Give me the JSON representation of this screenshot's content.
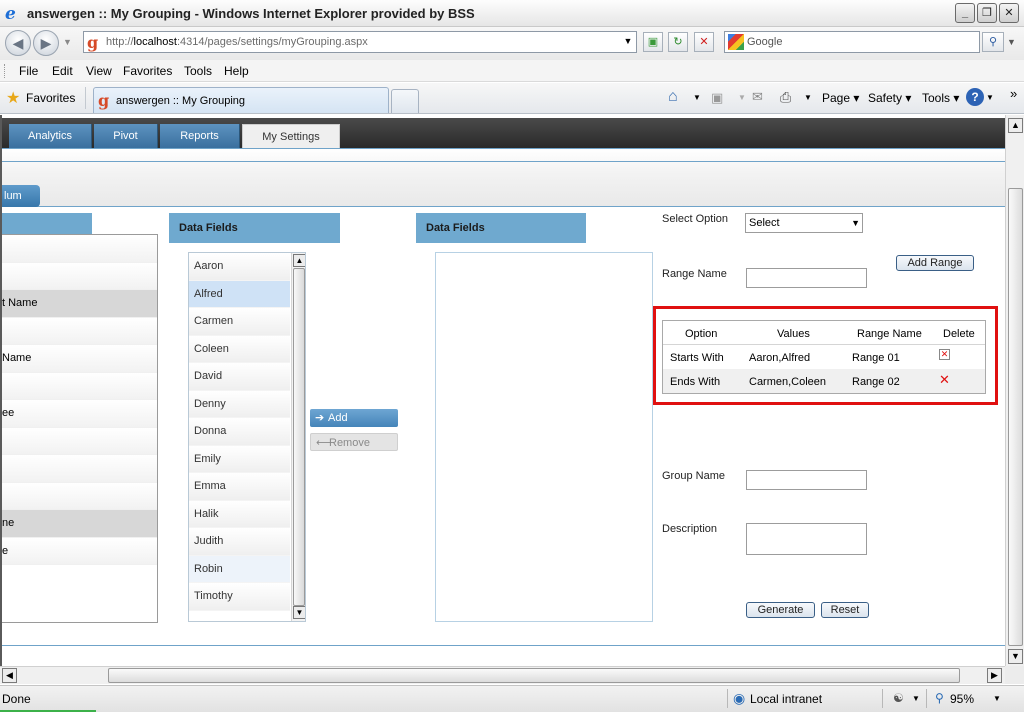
{
  "window": {
    "title": "answergen :: My Grouping - Windows Internet Explorer provided by BSS",
    "controls": [
      "_",
      "❐",
      "✕"
    ]
  },
  "address_bar": {
    "url_prefix": "http://",
    "url_host": "localhost",
    "url_rest": ":4314/pages/settings/myGrouping.aspx",
    "search_placeholder": "Google"
  },
  "menu": {
    "items": [
      {
        "label": "File",
        "accel": "F"
      },
      {
        "label": "Edit",
        "accel": "E"
      },
      {
        "label": "View",
        "accel": "V"
      },
      {
        "label": "Favorites",
        "accel": "a"
      },
      {
        "label": "Tools",
        "accel": "T"
      },
      {
        "label": "Help",
        "accel": "H"
      }
    ]
  },
  "favorites_bar": {
    "favorites_label": "Favorites",
    "tab_title": "answergen :: My Grouping",
    "commands": [
      "Page",
      "Safety",
      "Tools"
    ]
  },
  "app_nav": {
    "tabs": [
      "Analytics",
      "Pivot",
      "Reports",
      "My Settings"
    ],
    "active": "My Settings",
    "collapse_label": "lum"
  },
  "left_panel": {
    "rows": [
      "",
      "",
      "t Name",
      "",
      " Name",
      "",
      "ee",
      "",
      "",
      "",
      "ne",
      "e"
    ],
    "selected_rows": [
      2,
      10
    ]
  },
  "source_panel": {
    "header": "Data Fields",
    "items": [
      "Aaron",
      "Alfred",
      "Carmen",
      "Coleen",
      "David",
      "Denny",
      "Donna",
      "Emily",
      "Emma",
      "Halik",
      "Judith",
      "Robin",
      "Timothy"
    ],
    "selected": "Alfred",
    "hovered": "Robin"
  },
  "buttons": {
    "add": "Add",
    "remove": "Remove",
    "add_range": "Add Range",
    "generate": "Generate",
    "reset": "Reset"
  },
  "target_panel": {
    "header": "Data Fields"
  },
  "form": {
    "select_option_label": "Select Option",
    "select_option_value": "Select",
    "range_name_label": "Range Name",
    "range_name_value": "",
    "group_name_label": "Group Name",
    "group_name_value": "",
    "description_label": "Description",
    "description_value": ""
  },
  "range_table": {
    "columns": [
      "Option",
      "Values",
      "Range Name",
      "Delete"
    ],
    "rows": [
      {
        "option": "Starts With",
        "values": "Aaron,Alfred",
        "range_name": "Range 01"
      },
      {
        "option": "Ends With",
        "values": "Carmen,Coleen",
        "range_name": "Range 02"
      }
    ]
  },
  "status_bar": {
    "status": "Done",
    "zone": "Local intranet",
    "zoom": "95%"
  },
  "colors": {
    "accent": "#6fa9cf",
    "highlight_border": "#e01010",
    "nav_bg": "#2a2a2a"
  }
}
